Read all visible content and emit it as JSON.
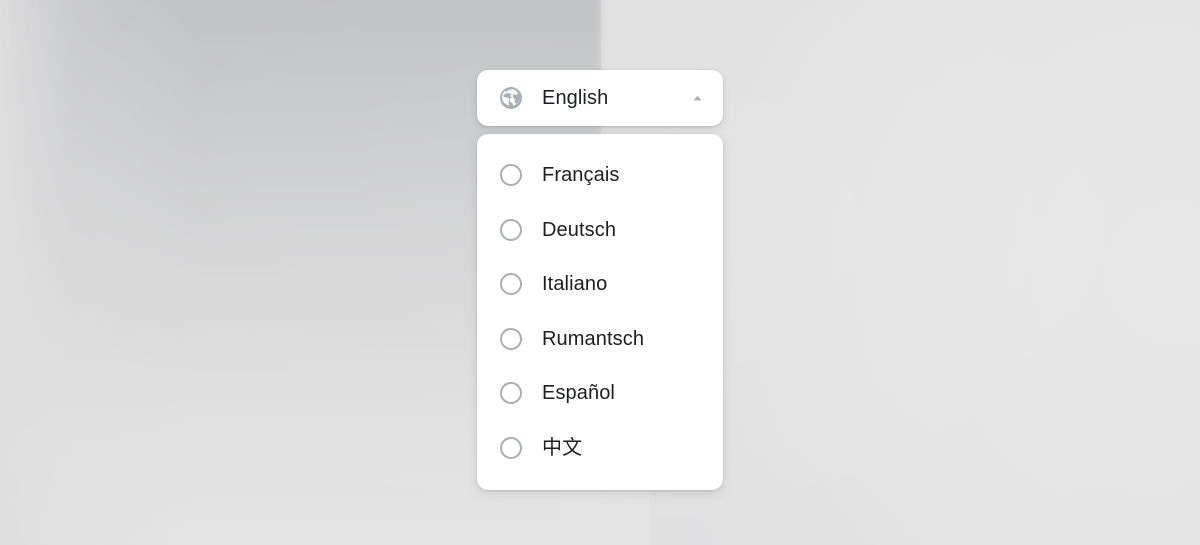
{
  "background": {
    "left_tone": "#c4c5c6",
    "right_tone": "#e8e8e8",
    "seam_tone": "#d2d2d4"
  },
  "language_picker": {
    "selector": {
      "icon": "globe-icon",
      "selected_label": "English",
      "expand_icon": "chevron-up-icon",
      "expanded": "true"
    },
    "options": [
      {
        "label": "Français",
        "icon": "radio-unselected-icon",
        "selected": "false"
      },
      {
        "label": "Deutsch",
        "icon": "radio-unselected-icon",
        "selected": "false"
      },
      {
        "label": "Italiano",
        "icon": "radio-unselected-icon",
        "selected": "false"
      },
      {
        "label": "Rumantsch",
        "icon": "radio-unselected-icon",
        "selected": "false"
      },
      {
        "label": "Español",
        "icon": "radio-unselected-icon",
        "selected": "false"
      },
      {
        "label": "中文",
        "icon": "radio-unselected-icon",
        "selected": "false"
      }
    ],
    "colors": {
      "panel_background": "#ffffff",
      "text": "#1c1e21",
      "radio_border": "#a9afb5",
      "icon_gray": "#aab2b8"
    }
  }
}
